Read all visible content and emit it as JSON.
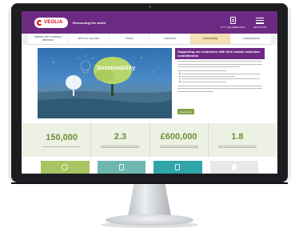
{
  "site": {
    "logo_text": "VEOLIA",
    "tagline": "Resourcing the world",
    "header_actions": [
      {
        "label": "CITY SCHEMES ETC",
        "icon": "document-icon"
      },
      {
        "label": "SECTIONS",
        "icon": "menu-icon"
      }
    ],
    "nav_tabs": [
      {
        "label": "Together, we're making a difference",
        "active": false
      },
      {
        "label": "We're on a journey",
        "active": false
      },
      {
        "label": "People",
        "active": false
      },
      {
        "label": "Customers",
        "active": false
      },
      {
        "label": "Sustainability",
        "active": true
      },
      {
        "label": "Looking ahead",
        "active": false
      }
    ],
    "hero": {
      "image_word": "Sustainability",
      "title": "Supporting our customers with their carbon reduction commitments",
      "button_label": "Read More"
    },
    "stats": [
      {
        "value": "150,000"
      },
      {
        "value": "2.3"
      },
      {
        "value": "£600,000"
      },
      {
        "value": "1.8"
      }
    ],
    "tiles": [
      {
        "color": "#a9c563",
        "icon": "recycle-icon"
      },
      {
        "color": "#6fb8b2",
        "icon": "battery-icon"
      },
      {
        "color": "#2fa4a9",
        "icon": "document-icon"
      },
      {
        "color": "#e8e8e8",
        "icon": "bulb-icon"
      }
    ],
    "colors": {
      "brand_purple": "#6d2a83",
      "accent_green": "#6f8e39",
      "active_tab": "#f4e0b6"
    }
  }
}
